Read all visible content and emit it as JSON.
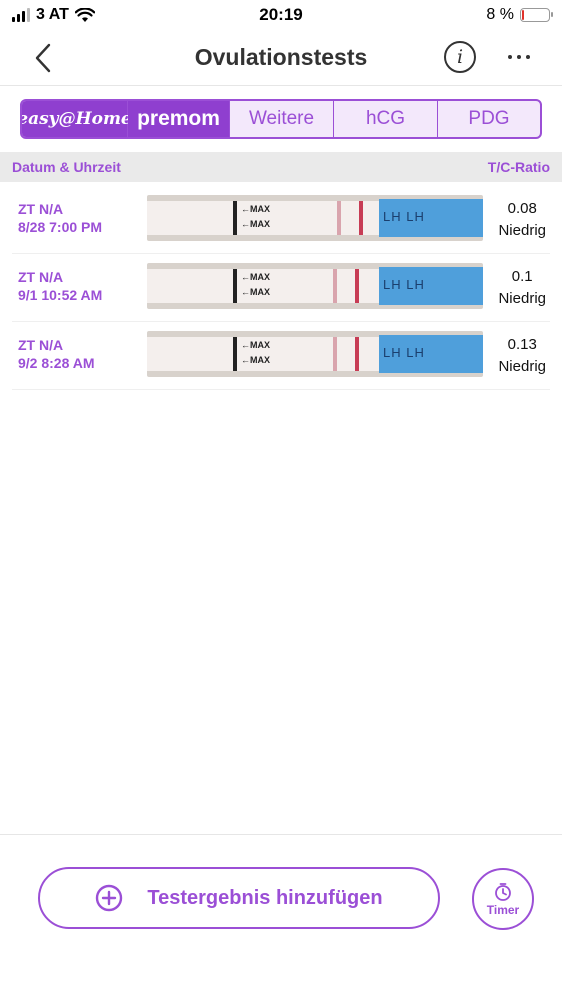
{
  "status_bar": {
    "carrier": "3 AT",
    "time": "20:19",
    "battery": "8 %",
    "battery_level": 0.08
  },
  "nav": {
    "title": "Ovulationstests",
    "info_glyph": "i",
    "back_icon": "chevron-left-icon",
    "more_icon": "ellipsis-icon"
  },
  "brand_tabs": {
    "easy_home": "easy@Home",
    "premom": "premom",
    "weitere": "Weitere",
    "hcg": "hCG",
    "pdg": "PDG",
    "selected": "easy@Home"
  },
  "table": {
    "col_date": "Datum & Uhrzeit",
    "col_ratio": "T/C-Ratio",
    "rows": [
      {
        "zt": "ZT N/A",
        "datetime": "8/28 7:00 PM",
        "ratio": "0.08",
        "level": "Niedrig"
      },
      {
        "zt": "ZT N/A",
        "datetime": "9/1 10:52 AM",
        "ratio": "0.1",
        "level": "Niedrig"
      },
      {
        "zt": "ZT N/A",
        "datetime": "9/2 8:28 AM",
        "ratio": "0.13",
        "level": "Niedrig"
      }
    ]
  },
  "strip": {
    "max_label": "←MAX"
  },
  "footer": {
    "add_label": "Testergebnis hinzufügen",
    "timer_label": "Timer"
  },
  "colors": {
    "accent": "#9b4fd6",
    "accent_dark": "#8f3fcf",
    "control_line": "#c73c55",
    "test_line": "#d9a4ad",
    "battery_low": "#e0322b"
  }
}
